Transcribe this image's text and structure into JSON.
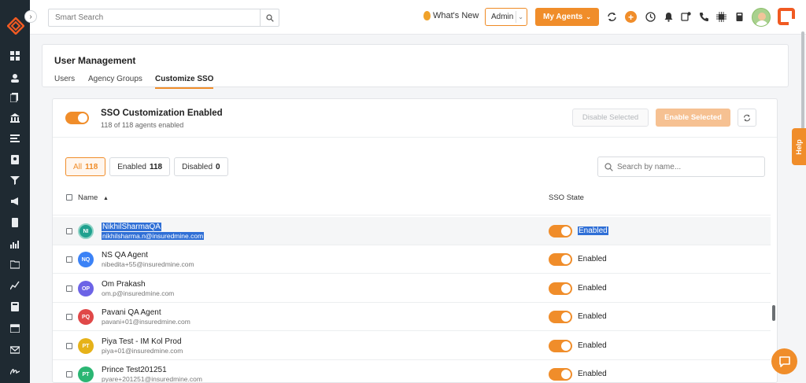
{
  "topbar": {
    "search_placeholder": "Smart Search",
    "whats_new": "What's New",
    "role": "Admin",
    "my_agents": "My Agents"
  },
  "header": {
    "title": "User Management",
    "tabs": [
      {
        "label": "Users"
      },
      {
        "label": "Agency Groups"
      },
      {
        "label": "Customize SSO"
      }
    ]
  },
  "sso": {
    "title": "SSO Customization Enabled",
    "subtitle": "118 of 118 agents enabled",
    "disable_selected": "Disable Selected",
    "enable_selected": "Enable Selected"
  },
  "filters": [
    {
      "label": "All",
      "count": "118"
    },
    {
      "label": "Enabled",
      "count": "118"
    },
    {
      "label": "Disabled",
      "count": "0"
    }
  ],
  "name_search_placeholder": "Search by name...",
  "table": {
    "col_name": "Name",
    "col_state": "SSO State",
    "rows": [
      {
        "initials": "NI",
        "name": "NikhilSharmaQA",
        "email": "nikhilsharma.n@insuredmine.com",
        "state": "Enabled",
        "color": "#1fa18f"
      },
      {
        "initials": "NQ",
        "name": "NS QA Agent",
        "email": "nibedita+55@insuredmine.com",
        "state": "Enabled",
        "color": "#3b82f6"
      },
      {
        "initials": "OP",
        "name": "Om Prakash",
        "email": "om.p@insuredmine.com",
        "state": "Enabled",
        "color": "#6c63e6"
      },
      {
        "initials": "PQ",
        "name": "Pavani QA Agent",
        "email": "pavani+01@insuredmine.com",
        "state": "Enabled",
        "color": "#e04848"
      },
      {
        "initials": "PT",
        "name": "Piya Test - IM Kol Prod",
        "email": "piya+01@insuredmine.com",
        "state": "Enabled",
        "color": "#e6b219"
      },
      {
        "initials": "PT",
        "name": "Prince Test201251",
        "email": "pyare+201251@insuredmine.com",
        "state": "Enabled",
        "color": "#2bb673"
      }
    ]
  },
  "help_label": "Help",
  "colors": {
    "accent": "#f08d2a",
    "sidebar": "#1f2a32"
  }
}
